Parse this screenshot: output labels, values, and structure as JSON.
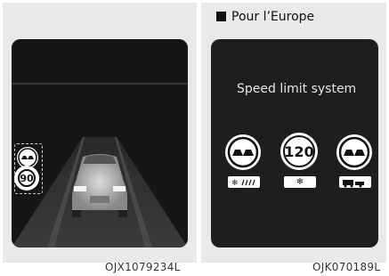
{
  "left_panel": {
    "signs": {
      "speed_value": "90"
    },
    "caption": "OJX1079234L"
  },
  "right_panel": {
    "title": "Pour l’Europe",
    "heading": "Speed limit system",
    "signs": [
      {
        "name": "no-overtaking",
        "sub_icon": "snow-rain-icon"
      },
      {
        "name": "speed-limit",
        "value": "120",
        "sub_icon": "snowflake-icon"
      },
      {
        "name": "no-overtaking",
        "sub_icon": "car-trailer-icon"
      }
    ],
    "caption": "OJK070189L"
  },
  "colors": {
    "panel_bg": "#e9e9e9",
    "screen_bg": "#1e1e1e",
    "sign_ring": "#ffffff",
    "sign_fill": "#ffffff"
  }
}
